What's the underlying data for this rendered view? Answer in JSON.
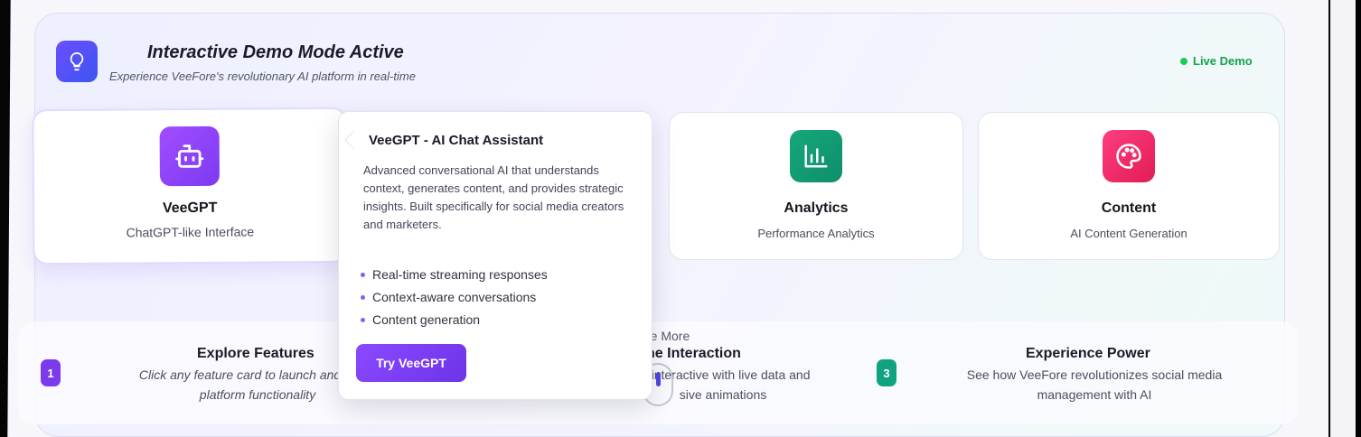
{
  "header": {
    "title": "Interactive Demo Mode Active",
    "subtitle": "Experience VeeFore's revolutionary AI platform in real-time",
    "icon": "lightbulb-icon",
    "live_label": "Live Demo"
  },
  "features": [
    {
      "title": "VeeGPT",
      "subtitle": "ChatGPT-like Interface",
      "icon": "robot-icon",
      "color": "#8b43f7"
    },
    {
      "title": "Analytics",
      "subtitle": "Performance Analytics",
      "icon": "bar-chart-icon",
      "color": "#12a077"
    },
    {
      "title": "Content",
      "subtitle": "AI Content Generation",
      "icon": "palette-icon",
      "color": "#f02d6b"
    }
  ],
  "tooltip": {
    "title": "VeeGPT - AI Chat Assistant",
    "description": "Advanced conversational AI that understands context, generates content, and provides strategic insights. Built specifically for social media creators and marketers.",
    "bullets": [
      "Real-time streaming responses",
      "Context-aware conversations",
      "Content generation"
    ],
    "button_label": "Try VeeGPT"
  },
  "steps": [
    {
      "number": "1",
      "title": "Explore Features",
      "desc_visible": "Click any feature card to launch and exper",
      "desc_line2": "platform functionality"
    },
    {
      "title_visible": "ne Interaction",
      "desc_visible": "lly interactive with live data and",
      "desc_line2": "sive animations"
    },
    {
      "number": "3",
      "title": "Experience Power",
      "description": "See how VeeFore revolutionizes social media management with AI"
    }
  ],
  "explore_more": "Explore More",
  "colors": {
    "accent_purple": "#7c3aed",
    "accent_green": "#10a37f",
    "live_green": "#16a34a"
  }
}
